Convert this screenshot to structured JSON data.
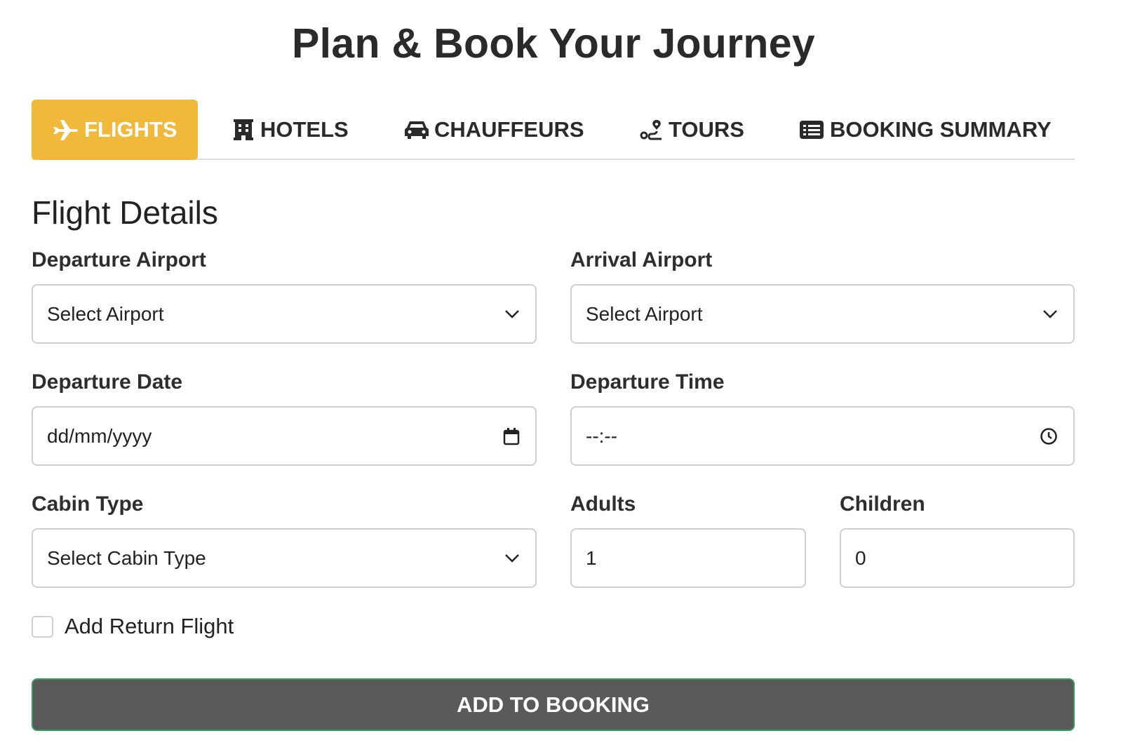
{
  "page": {
    "title": "Plan & Book Your Journey"
  },
  "tabs": [
    {
      "label": "FLIGHTS",
      "icon": "plane-icon",
      "active": true
    },
    {
      "label": "HOTELS",
      "icon": "hotel-icon",
      "active": false
    },
    {
      "label": "CHAUFFEURS",
      "icon": "car-icon",
      "active": false
    },
    {
      "label": "TOURS",
      "icon": "route-icon",
      "active": false
    },
    {
      "label": "BOOKING SUMMARY",
      "icon": "list-icon",
      "active": false
    }
  ],
  "form": {
    "section_title": "Flight Details",
    "departure_airport": {
      "label": "Departure Airport",
      "value": "Select Airport"
    },
    "arrival_airport": {
      "label": "Arrival Airport",
      "value": "Select Airport"
    },
    "departure_date": {
      "label": "Departure Date",
      "placeholder": "dd/mm/yyyy"
    },
    "departure_time": {
      "label": "Departure Time",
      "placeholder": "--:--"
    },
    "cabin_type": {
      "label": "Cabin Type",
      "value": "Select Cabin Type"
    },
    "adults": {
      "label": "Adults",
      "value": "1"
    },
    "children": {
      "label": "Children",
      "value": "0"
    },
    "return_flight": {
      "label": "Add Return Flight",
      "checked": false
    },
    "submit_label": "ADD TO BOOKING"
  },
  "colors": {
    "active_tab": "#f0b93a",
    "button_bg": "#5a5a5a",
    "button_border": "#2f9e5c",
    "input_border": "#cfcfcf"
  }
}
